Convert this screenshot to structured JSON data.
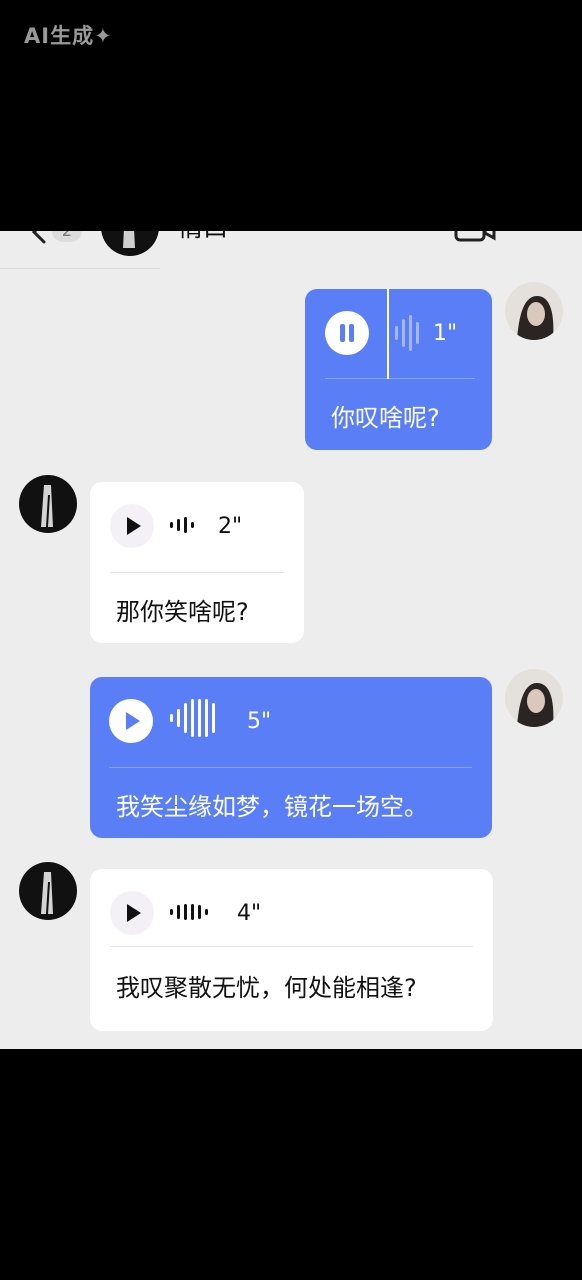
{
  "watermark": "AI生成✦",
  "header": {
    "unread_count": "2",
    "contact_name": "情口"
  },
  "messages": [
    {
      "sender": "me",
      "duration": "1\"",
      "state": "playing",
      "transcript": "你叹啥呢?"
    },
    {
      "sender": "contact",
      "duration": "2\"",
      "state": "paused",
      "transcript": "那你笑啥呢?"
    },
    {
      "sender": "me",
      "duration": "5\"",
      "state": "paused",
      "transcript": "我笑尘缘如梦，镜花一场空。"
    },
    {
      "sender": "contact",
      "duration": "4\"",
      "state": "paused",
      "transcript": "我叹聚散无忧，何处能相逢?"
    }
  ],
  "colors": {
    "accent_blue": "#5a7ef5",
    "chat_bg": "#ededed"
  },
  "icons": [
    "back-icon",
    "video-call-icon",
    "more-icon",
    "pause-icon",
    "play-icon",
    "voice-wave-icon"
  ]
}
